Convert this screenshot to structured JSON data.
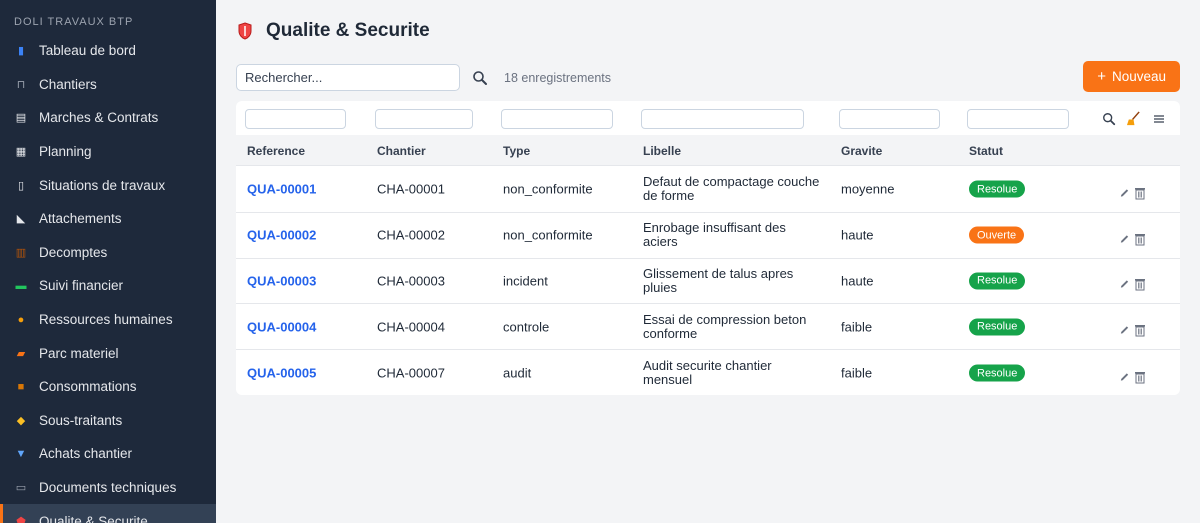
{
  "sidebar": {
    "brand": "DOLI TRAVAUX BTP",
    "items": [
      {
        "label": "Tableau de bord",
        "icon": "bar-chart-icon",
        "color": "#3b82f6"
      },
      {
        "label": "Chantiers",
        "icon": "crane-icon",
        "color": "#9ca3af"
      },
      {
        "label": "Marches & Contrats",
        "icon": "document-icon",
        "color": "#e5e7eb"
      },
      {
        "label": "Planning",
        "icon": "calendar-icon",
        "color": "#e5e7eb"
      },
      {
        "label": "Situations de travaux",
        "icon": "report-icon",
        "color": "#e5e7eb"
      },
      {
        "label": "Attachements",
        "icon": "triangle-ruler-icon",
        "color": "#e5e7eb"
      },
      {
        "label": "Decomptes",
        "icon": "ledger-icon",
        "color": "#b45309"
      },
      {
        "label": "Suivi financier",
        "icon": "money-icon",
        "color": "#22c55e"
      },
      {
        "label": "Ressources humaines",
        "icon": "worker-icon",
        "color": "#f59e0b"
      },
      {
        "label": "Parc materiel",
        "icon": "truck-icon",
        "color": "#f97316"
      },
      {
        "label": "Consommations",
        "icon": "box-icon",
        "color": "#d97706"
      },
      {
        "label": "Sous-traitants",
        "icon": "handshake-icon",
        "color": "#fbbf24"
      },
      {
        "label": "Achats chantier",
        "icon": "cart-icon",
        "color": "#60a5fa"
      },
      {
        "label": "Documents techniques",
        "icon": "folder-icon",
        "color": "#9ca3af"
      },
      {
        "label": "Qualite & Securite",
        "icon": "shield-icon",
        "color": "#ef4444",
        "active": true
      }
    ]
  },
  "page": {
    "title": "Qualite & Securite",
    "search_placeholder": "Rechercher...",
    "count": "18 enregistrements",
    "new_button": "Nouveau",
    "accent": "#f97316"
  },
  "table": {
    "columns": [
      "Reference",
      "Chantier",
      "Type",
      "Libelle",
      "Gravite",
      "Statut"
    ],
    "rows": [
      {
        "reference": "QUA-00001",
        "chantier": "CHA-00001",
        "type": "non_conformite",
        "libelle": "Defaut de compactage couche de forme",
        "gravite": "moyenne",
        "statut": "Resolue"
      },
      {
        "reference": "QUA-00002",
        "chantier": "CHA-00002",
        "type": "non_conformite",
        "libelle": "Enrobage insuffisant des aciers",
        "gravite": "haute",
        "statut": "Ouverte"
      },
      {
        "reference": "QUA-00003",
        "chantier": "CHA-00003",
        "type": "incident",
        "libelle": "Glissement de talus apres pluies",
        "gravite": "haute",
        "statut": "Resolue"
      },
      {
        "reference": "QUA-00004",
        "chantier": "CHA-00004",
        "type": "controle",
        "libelle": "Essai de compression beton conforme",
        "gravite": "faible",
        "statut": "Resolue"
      },
      {
        "reference": "QUA-00005",
        "chantier": "CHA-00007",
        "type": "audit",
        "libelle": "Audit securite chantier mensuel",
        "gravite": "faible",
        "statut": "Resolue"
      }
    ],
    "status_colors": {
      "Resolue": "#16a34a",
      "Ouverte": "#f97316"
    }
  }
}
